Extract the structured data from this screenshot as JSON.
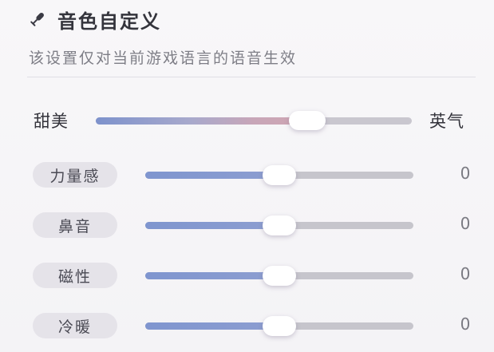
{
  "header": {
    "title": "音色自定义",
    "subtitle": "该设置仅对当前游戏语言的语音生效",
    "icon": "microphone-icon"
  },
  "main_slider": {
    "left_label": "甜美",
    "right_label": "英气",
    "value_fraction": 0.67
  },
  "sliders": [
    {
      "label": "力量感",
      "value": "0",
      "value_fraction": 0.5
    },
    {
      "label": "鼻音",
      "value": "0",
      "value_fraction": 0.5
    },
    {
      "label": "磁性",
      "value": "0",
      "value_fraction": 0.5
    },
    {
      "label": "冷暖",
      "value": "0",
      "value_fraction": 0.5
    }
  ],
  "colors": {
    "accent_blue": "#7f95cf",
    "accent_pink": "#cfa5b2",
    "track": "#c6c5cc",
    "pill": "#e5e3e9"
  }
}
